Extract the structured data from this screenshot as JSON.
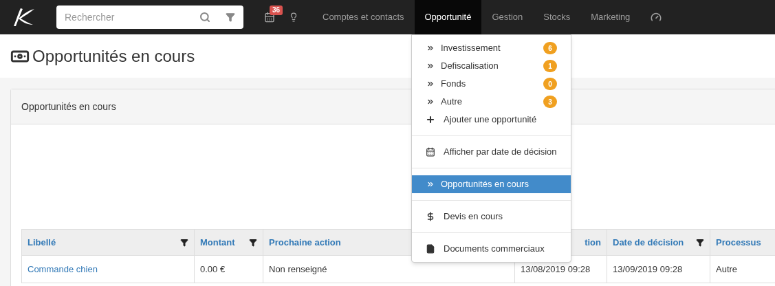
{
  "navbar": {
    "search": {
      "placeholder": "Rechercher"
    },
    "calendar_badge": "36",
    "items": [
      {
        "label": "Comptes et contacts",
        "selected": false
      },
      {
        "label": "Opportunité",
        "selected": true
      },
      {
        "label": "Gestion",
        "selected": false
      },
      {
        "label": "Stocks",
        "selected": false
      },
      {
        "label": "Marketing",
        "selected": false
      }
    ]
  },
  "dropdown": {
    "groups": [
      [
        {
          "kind": "category",
          "label": "Investissement",
          "badge": "6",
          "selected": false
        },
        {
          "kind": "category",
          "label": "Defiscalisation",
          "badge": "1",
          "selected": false
        },
        {
          "kind": "category",
          "label": "Fonds",
          "badge": "0",
          "selected": false
        },
        {
          "kind": "category",
          "label": "Autre",
          "badge": "3",
          "selected": false
        },
        {
          "kind": "add",
          "label": "Ajouter une opportunité",
          "selected": false
        }
      ],
      [
        {
          "kind": "calendar",
          "label": "Afficher par date de décision",
          "selected": false
        }
      ],
      [
        {
          "kind": "category",
          "label": "Opportunités en cours",
          "selected": true
        }
      ],
      [
        {
          "kind": "money",
          "label": "Devis en cours",
          "selected": false
        }
      ],
      [
        {
          "kind": "file",
          "label": "Documents commerciaux",
          "selected": false
        }
      ]
    ]
  },
  "page_title": "Opportunités en cours",
  "panel": {
    "title": "Opportunités en cours",
    "table": {
      "columns": [
        {
          "label": "Libellé",
          "filter": true
        },
        {
          "label": "Montant",
          "filter": true
        },
        {
          "label": "Prochaine action"
        },
        {
          "label": "tion"
        },
        {
          "label": "Date de décision",
          "filter": true
        },
        {
          "label": "Processus",
          "filter": false
        }
      ],
      "rows": [
        {
          "cells": [
            "Commande chien",
            "0.00 €",
            "Non renseigné",
            "13/08/2019 09:28",
            "13/09/2019 09:28",
            "Autre"
          ]
        }
      ]
    }
  }
}
